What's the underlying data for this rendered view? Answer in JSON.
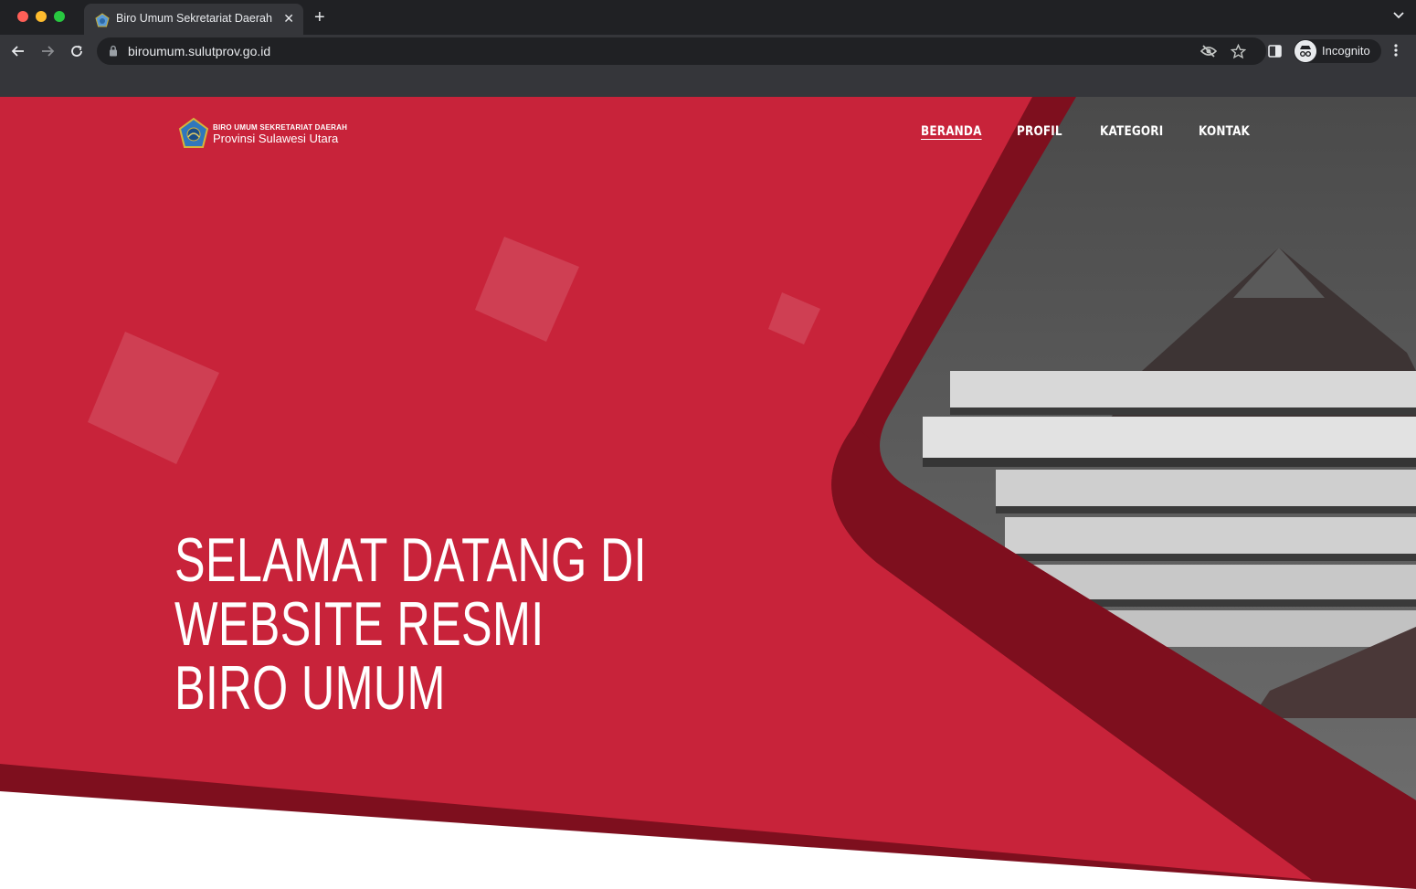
{
  "browser": {
    "tab_title": "Biro Umum Sekretariat Daerah",
    "url": "biroumum.sulutprov.go.id",
    "profile_label": "Incognito"
  },
  "site": {
    "logo": {
      "line1": "BIRO UMUM SEKRETARIAT DAERAH",
      "line2": "Provinsi Sulawesi Utara"
    },
    "nav": [
      {
        "label": "BERANDA",
        "active": true
      },
      {
        "label": "PROFIL",
        "active": false
      },
      {
        "label": "KATEGORI",
        "active": false
      },
      {
        "label": "KONTAK",
        "active": false
      }
    ],
    "hero": {
      "lines": [
        "SELAMAT DATANG DI",
        "WEBSITE RESMI",
        "BIRO UMUM"
      ]
    }
  },
  "colors": {
    "brand_red": "#c8233a",
    "dark_red": "#7e0f1e",
    "chrome_dark": "#202124",
    "chrome_mid": "#35363a"
  }
}
